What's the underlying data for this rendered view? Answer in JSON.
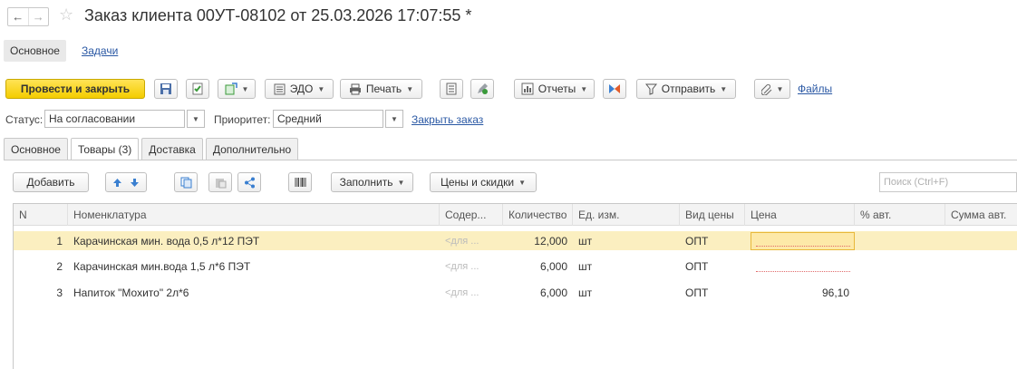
{
  "window": {
    "title": "Заказ клиента 00УТ-08102 от 25.03.2026 17:07:55 *",
    "back_icon": "arrow-left-icon",
    "forward_icon": "arrow-right-icon",
    "favorite_icon": "star-outline-icon"
  },
  "top_tabs": {
    "main": "Основное",
    "tasks": "Задачи"
  },
  "toolbar": {
    "post_close": "Провести и закрыть",
    "edo": "ЭДО",
    "print": "Печать",
    "reports": "Отчеты",
    "send": "Отправить",
    "files": "Файлы"
  },
  "status_row": {
    "status_label": "Статус:",
    "status_value": "На согласовании",
    "priority_label": "Приоритет:",
    "priority_value": "Средний",
    "close_order": "Закрыть заказ"
  },
  "tabs": [
    "Основное",
    "Товары (3)",
    "Доставка",
    "Дополнительно"
  ],
  "goods_toolbar": {
    "add": "Добавить",
    "fill": "Заполнить",
    "prices": "Цены и скидки",
    "search_placeholder": "Поиск (Ctrl+F)"
  },
  "table": {
    "columns": [
      "N",
      "Номенклатура",
      "Содер...",
      "Количество",
      "Ед. изм.",
      "Вид цены",
      "Цена",
      "% авт.",
      "Сумма авт."
    ],
    "rows": [
      {
        "n": "1",
        "name": "Карачинская мин. вода 0,5 л*12 ПЭТ",
        "content": "<для ...",
        "qty": "12,000",
        "unit": "шт",
        "price_type": "ОПТ",
        "price": "",
        "auto_pct": "",
        "auto_sum": ""
      },
      {
        "n": "2",
        "name": "Карачинская мин.вода  1,5 л*6 ПЭТ",
        "content": "<для ...",
        "qty": "6,000",
        "unit": "шт",
        "price_type": "ОПТ",
        "price": "",
        "auto_pct": "",
        "auto_sum": ""
      },
      {
        "n": "3",
        "name": "Напиток \"Мохито\" 2л*6",
        "content": "<для ...",
        "qty": "6,000",
        "unit": "шт",
        "price_type": "ОПТ",
        "price": "96,10",
        "auto_pct": "",
        "auto_sum": ""
      }
    ]
  },
  "colors": {
    "accent_yellow": "#f4cd00",
    "link": "#2a58a4",
    "selected_row": "#fbefc0"
  }
}
